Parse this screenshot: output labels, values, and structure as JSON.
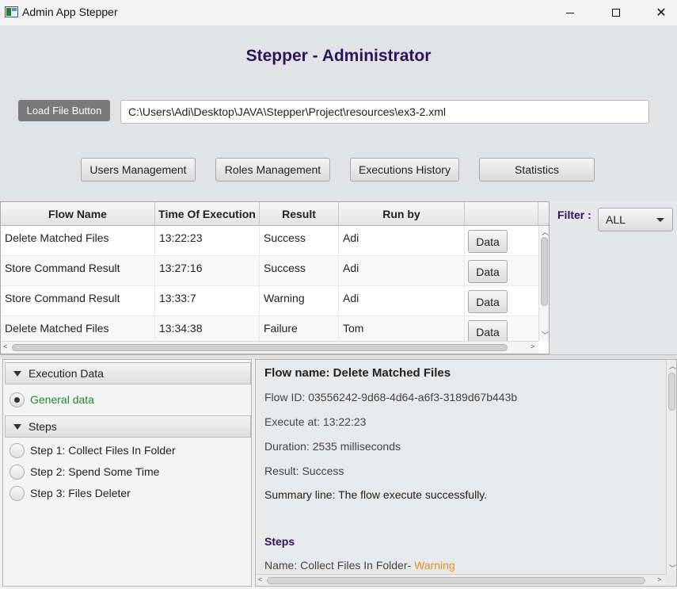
{
  "window": {
    "title": "Admin App Stepper",
    "minimize_label": "–",
    "maximize_label": "□",
    "close_label": "✕"
  },
  "header": {
    "title": "Stepper - Administrator",
    "load_button_label": "Load File Button",
    "file_path": "C:\\Users\\Adi\\Desktop\\JAVA\\Stepper\\Project\\resources\\ex3-2.xml"
  },
  "nav": {
    "users_label": "Users Management",
    "roles_label": "Roles Management",
    "history_label": "Executions History",
    "statistics_label": "Statistics"
  },
  "table": {
    "columns": [
      "Flow Name",
      "Time Of Execution",
      "Result",
      "Run by",
      ""
    ],
    "rows": [
      {
        "flow": "Delete Matched Files",
        "time": "13:22:23",
        "result": "Success",
        "run_by": "Adi",
        "action": "Data"
      },
      {
        "flow": "Store Command Result",
        "time": "13:27:16",
        "result": "Success",
        "run_by": "Adi",
        "action": "Data"
      },
      {
        "flow": "Store Command Result",
        "time": "13:33:7",
        "result": "Warning",
        "run_by": "Adi",
        "action": "Data"
      },
      {
        "flow": "Delete Matched Files",
        "time": "13:34:38",
        "result": "Failure",
        "run_by": "Tom",
        "action": "Data"
      }
    ]
  },
  "filter": {
    "label": "Filter :",
    "selected": "ALL"
  },
  "tree": {
    "execution_data_label": "Execution Data",
    "general_data_label": "General data",
    "steps_label": "Steps",
    "steps": [
      "Step 1: Collect Files In Folder",
      "Step 2: Spend Some Time",
      "Step 3: Files Deleter"
    ]
  },
  "details": {
    "flow_name": "Flow name: Delete Matched Files",
    "flow_id": "Flow ID: 03556242-9d68-4d64-a6f3-3189d67b443b",
    "execute_at": "Execute at: 13:22:23",
    "duration": "Duration: 2535 milliseconds",
    "result": "Result: Success",
    "summary": "Summary line: The flow execute successfully.",
    "steps_title": "Steps",
    "step_name": "Name: Collect Files In Folder-",
    "step_status": "Warning"
  },
  "colors": {
    "title": "#2a1558",
    "general_data": "#1e8a2e",
    "warning": "#e8901a"
  }
}
